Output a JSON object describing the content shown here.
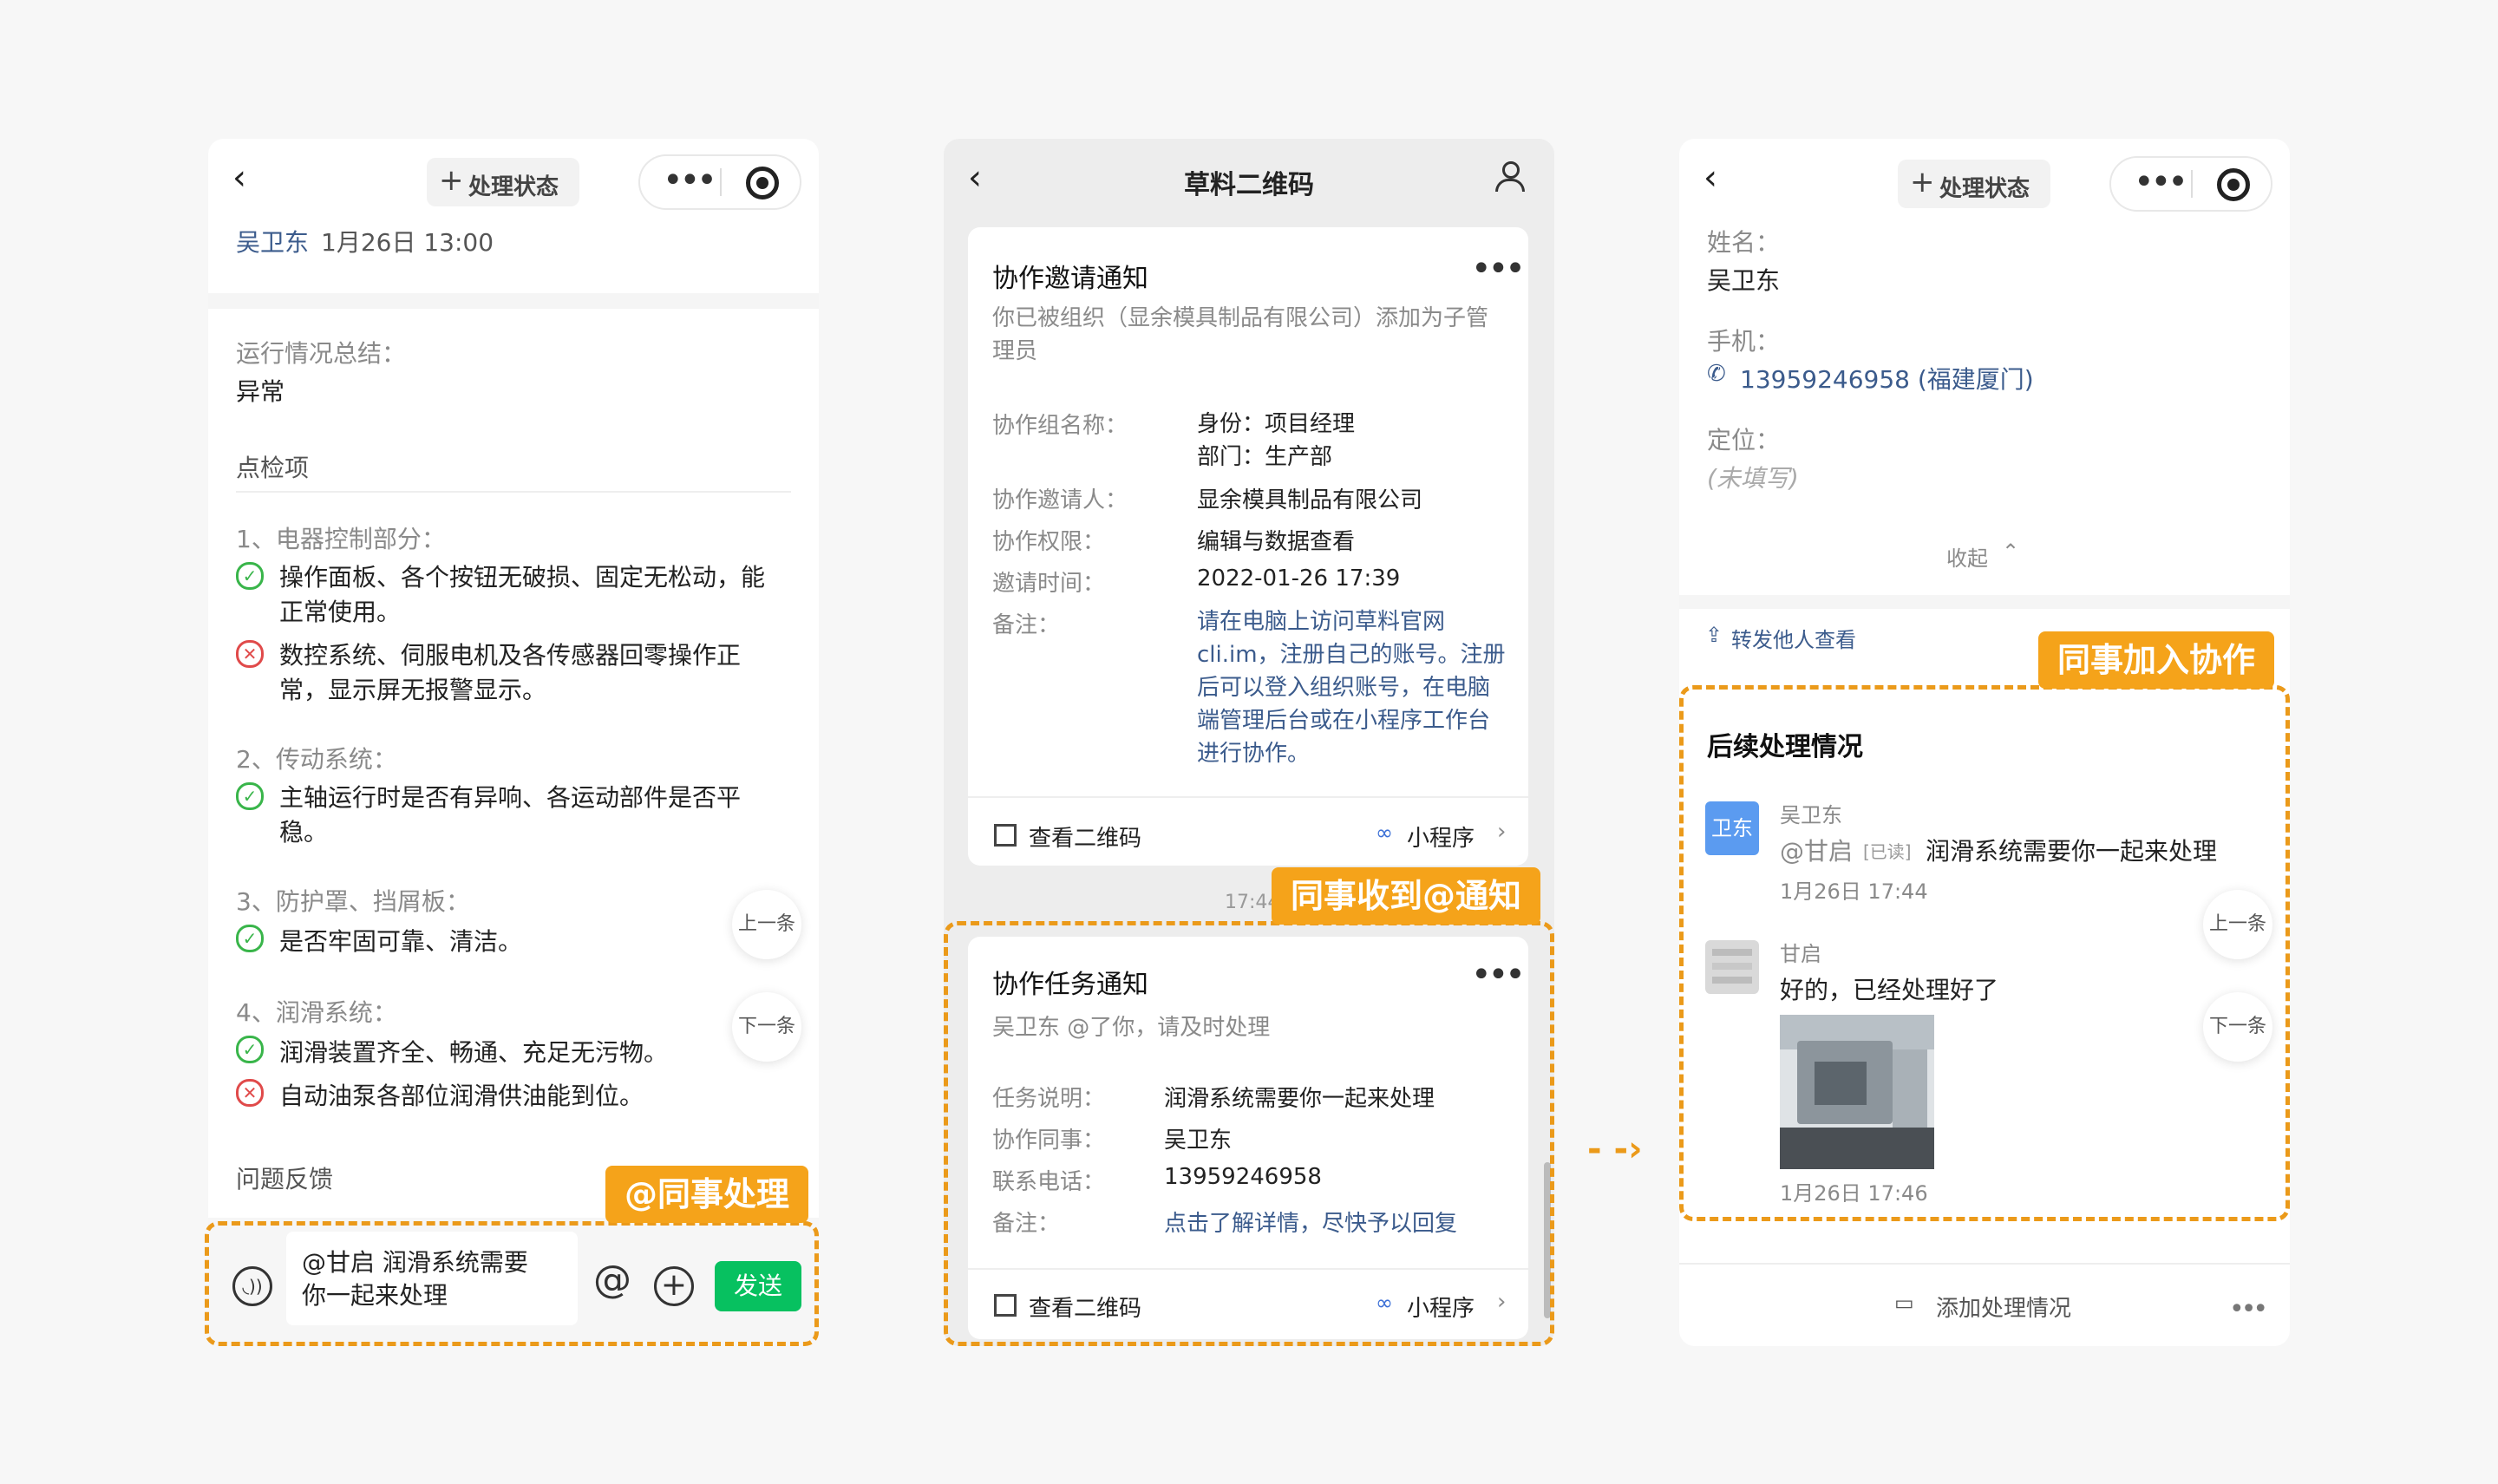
{
  "panel1": {
    "status_button": "处理状态",
    "author": "吴卫东",
    "datetime": "1月26日 13:00",
    "summary_label": "运行情况总结：",
    "summary_value": "异常",
    "checks_heading": "点检项",
    "sections": [
      {
        "title": "1、电器控制部分：",
        "items": [
          {
            "state": "ok",
            "lines": [
              "操作面板、各个按钮无破损、固定无松动，能",
              "正常使用。"
            ]
          },
          {
            "state": "fail",
            "lines": [
              "数控系统、伺服电机及各传感器回零操作正",
              "常，显示屏无报警显示。"
            ]
          }
        ]
      },
      {
        "title": "2、传动系统：",
        "items": [
          {
            "state": "ok",
            "lines": [
              "主轴运行时是否有异响、各运动部件是否平",
              "稳。"
            ]
          }
        ]
      },
      {
        "title": "3、防护罩、挡屑板：",
        "items": [
          {
            "state": "ok",
            "lines": [
              "是否牢固可靠、清洁。"
            ]
          }
        ]
      },
      {
        "title": "4、润滑系统：",
        "items": [
          {
            "state": "ok",
            "lines": [
              "润滑装置齐全、畅通、充足无污物。"
            ]
          },
          {
            "state": "fail",
            "lines": [
              "自动油泵各部位润滑供油能到位。"
            ]
          }
        ]
      }
    ],
    "feedback_heading": "问题反馈",
    "prev": "上一条",
    "next": "下一条",
    "input_line1": "@甘启 润滑系统需要",
    "input_line2": "你一起来处理",
    "send": "发送",
    "tag": "@同事处理"
  },
  "panel2": {
    "title": "草料二维码",
    "invite": {
      "title": "协作邀请通知",
      "desc_line1": "你已被组织（显余模具制品有限公司）添加为子管",
      "desc_line2": "理员",
      "rows": [
        {
          "label": "协作组名称：",
          "values": [
            "身份：项目经理",
            "部门：生产部"
          ]
        },
        {
          "label": "协作邀请人：",
          "values": [
            "显余模具制品有限公司"
          ]
        },
        {
          "label": "协作权限：",
          "values": [
            "编辑与数据查看"
          ]
        },
        {
          "label": "邀请时间：",
          "values": [
            "2022-01-26 17:39"
          ]
        }
      ],
      "note_label": "备注：",
      "note_lines": [
        "请在电脑上访问草料官网",
        "cli.im，注册自己的账号。注册",
        "后可以登入组织账号，在电脑",
        "端管理后台或在小程序工作台",
        "进行协作。"
      ],
      "qr": "查看二维码",
      "mini": "小程序"
    },
    "time": "17:44",
    "tag": "同事收到@通知",
    "task": {
      "title": "协作任务通知",
      "sub": "吴卫东 @了你，请及时处理",
      "rows": [
        {
          "label": "任务说明：",
          "value": "润滑系统需要你一起来处理"
        },
        {
          "label": "协作同事：",
          "value": "吴卫东"
        },
        {
          "label": "联系电话：",
          "value": "13959246958"
        }
      ],
      "note_label": "备注：",
      "note_value": "点击了解详情，尽快予以回复",
      "qr": "查看二维码",
      "mini": "小程序"
    }
  },
  "panel3": {
    "status_button": "处理状态",
    "name_label": "姓名：",
    "name_value": "吴卫东",
    "phone_label": "手机：",
    "phone_value": "13959246958 (福建厦门)",
    "loc_label": "定位：",
    "loc_value": "(未填写)",
    "collapse": "收起",
    "forward": "转发他人查看",
    "tag": "同事加入协作",
    "followup_title": "后续处理情况",
    "msg1": {
      "avatar": "卫东",
      "name": "吴卫东",
      "mention": "@甘启",
      "read": "[已读]",
      "text": "润滑系统需要你一起来处理",
      "time": "1月26日 17:44"
    },
    "msg2": {
      "name": "甘启",
      "text": "好的，已经处理好了",
      "time": "1月26日 17:46"
    },
    "prev": "上一条",
    "next": "下一条",
    "add": "添加处理情况"
  },
  "colors": {
    "accent": "#f5a31a",
    "dash": "#eb9a1a",
    "green": "#07c160",
    "link": "#3b5b8c"
  }
}
